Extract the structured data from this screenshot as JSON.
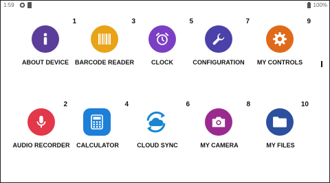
{
  "status_bar": {
    "time": "1:59",
    "battery": "100%",
    "icons": [
      "sync-status-icon",
      "sd-card-icon",
      "battery-icon"
    ]
  },
  "apps": [
    {
      "id": "about-device",
      "label": "ABOUT DEVICE",
      "number": "1",
      "color": "#5b3d9a",
      "icon": "info-icon"
    },
    {
      "id": "barcode-reader",
      "label": "BARCODE READER",
      "number": "3",
      "color": "#e8a317",
      "icon": "barcode-icon"
    },
    {
      "id": "clock",
      "label": "CLOCK",
      "number": "5",
      "color": "#7b3fc4",
      "icon": "alarm-clock-icon"
    },
    {
      "id": "configuration",
      "label": "CONFIGURATION",
      "number": "7",
      "color": "#4a42a8",
      "icon": "wrench-icon"
    },
    {
      "id": "my-controls",
      "label": "MY CONTROLS",
      "number": "9",
      "color": "#e06a1a",
      "icon": "gear-icon"
    },
    {
      "id": "audio-recorder",
      "label": "AUDIO RECORDER",
      "number": "2",
      "color": "#e3374a",
      "icon": "microphone-icon"
    },
    {
      "id": "calculator",
      "label": "CALCULATOR",
      "number": "4",
      "color": "#1e7fd8",
      "icon": "calculator-icon"
    },
    {
      "id": "cloud-sync",
      "label": "CLOUD SYNC",
      "number": "6",
      "color": "#1a86d0",
      "icon": "cloud-sync-icon"
    },
    {
      "id": "my-camera",
      "label": "MY CAMERA",
      "number": "8",
      "color": "#9a2a8e",
      "icon": "camera-icon"
    },
    {
      "id": "my-files",
      "label": "MY FILES",
      "number": "10",
      "color": "#2c4f9e",
      "icon": "folder-icon"
    }
  ]
}
